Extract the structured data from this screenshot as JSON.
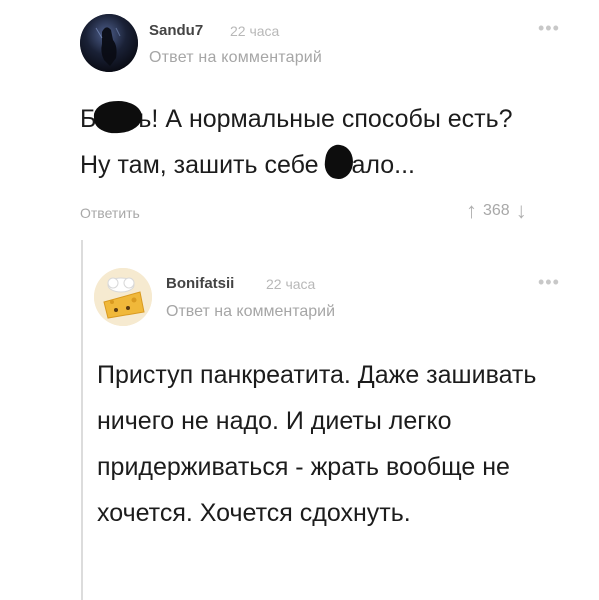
{
  "comment1": {
    "author": "Sandu7",
    "time": "22 часа",
    "reply_to_prefix": "Ответ на",
    "reply_to_link": "комментарий",
    "more": "•••",
    "text_part1": "ь! А нормальные способы есть?",
    "text_lead": "Б",
    "text_line2a": "Ну там, зашить себе ",
    "text_line2b": "ало...",
    "reply_button": "Ответить",
    "rating": "368",
    "upvote_icon": "arrow-up-icon",
    "downvote_icon": "arrow-down-icon"
  },
  "comment2": {
    "author": "Bonifatsii",
    "time": "22 часа",
    "reply_to_prefix": "Ответ на",
    "reply_to_link": "комментарий",
    "more": "•••",
    "text": "Приступ панкреатита. Даже зашивать ничего не надо. И диеты легко придерживаться - жрать вообще не хочется. Хочется сдохнуть."
  }
}
